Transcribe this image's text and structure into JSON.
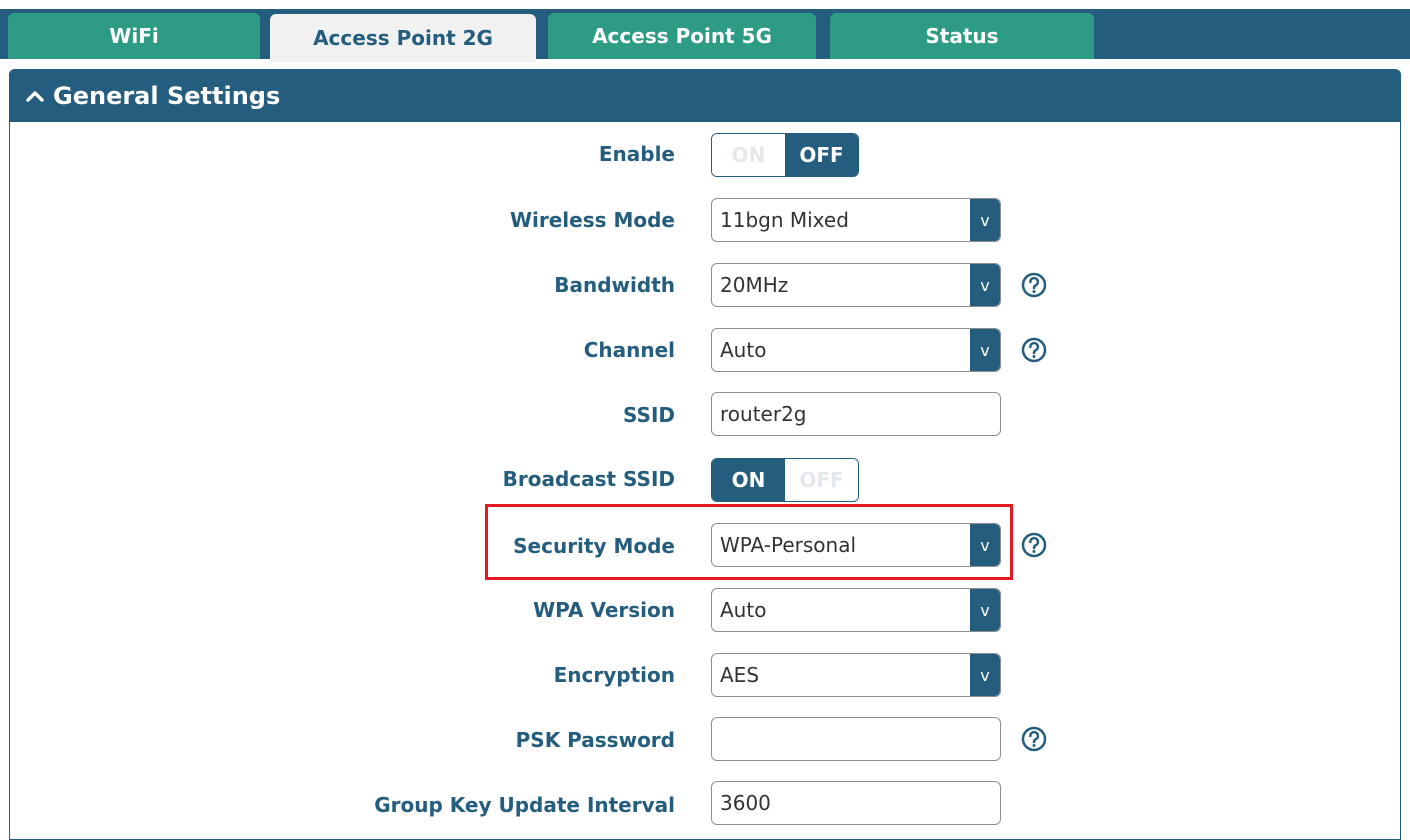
{
  "tabs": [
    {
      "label": "WiFi"
    },
    {
      "label": "Access Point 2G"
    },
    {
      "label": "Access Point 5G"
    },
    {
      "label": "Status"
    }
  ],
  "active_tab": "Access Point 2G",
  "section": {
    "title": "General Settings"
  },
  "fields": {
    "enable": {
      "label": "Enable",
      "on": "ON",
      "off": "OFF",
      "state": "OFF"
    },
    "wireless_mode": {
      "label": "Wireless Mode",
      "value": "11bgn Mixed"
    },
    "bandwidth": {
      "label": "Bandwidth",
      "value": "20MHz"
    },
    "channel": {
      "label": "Channel",
      "value": "Auto"
    },
    "ssid": {
      "label": "SSID",
      "value": "router2g"
    },
    "broadcast_ssid": {
      "label": "Broadcast SSID",
      "on": "ON",
      "off": "OFF",
      "state": "ON"
    },
    "security_mode": {
      "label": "Security Mode",
      "value": "WPA-Personal"
    },
    "wpa_version": {
      "label": "WPA Version",
      "value": "Auto"
    },
    "encryption": {
      "label": "Encryption",
      "value": "AES"
    },
    "psk_password": {
      "label": "PSK Password",
      "value": ""
    },
    "group_key_interval": {
      "label": "Group Key Update Interval",
      "value": "3600"
    }
  },
  "dropdown_arrow": "v",
  "colors": {
    "primary": "#245d7d",
    "tab": "#2e9b85",
    "highlight": "#e21b23"
  }
}
